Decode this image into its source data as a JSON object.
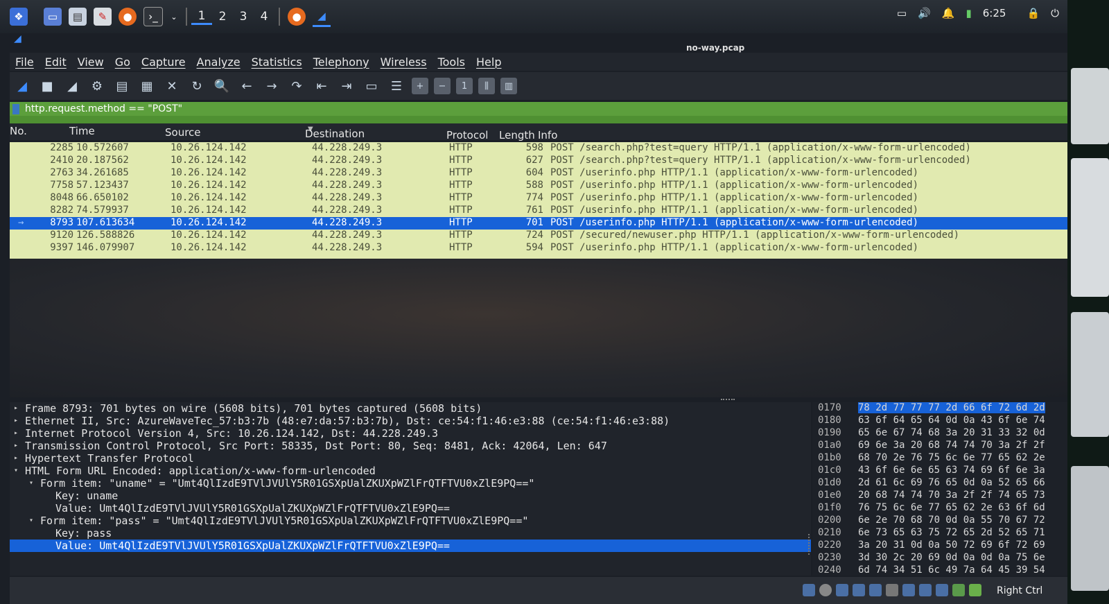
{
  "taskbar": {
    "workspaces": [
      "1",
      "2",
      "3",
      "4"
    ],
    "active_workspace": "1",
    "clock": "6:25"
  },
  "window": {
    "title": "no-way.pcap"
  },
  "menu": [
    "File",
    "Edit",
    "View",
    "Go",
    "Capture",
    "Analyze",
    "Statistics",
    "Telephony",
    "Wireless",
    "Tools",
    "Help"
  ],
  "filter": {
    "value": "http.request.method == \"POST\""
  },
  "columns": {
    "no": "No.",
    "time": "Time",
    "source": "Source",
    "destination": "Destination",
    "protocol": "Protocol",
    "length": "Length",
    "info": "Info"
  },
  "packets": [
    {
      "no": "2285",
      "time": "10.572607",
      "src": "10.26.124.142",
      "dst": "44.228.249.3",
      "proto": "HTTP",
      "len": "598",
      "info": "POST /search.php?test=query HTTP/1.1  (application/x-www-form-urlencoded)"
    },
    {
      "no": "2410",
      "time": "20.187562",
      "src": "10.26.124.142",
      "dst": "44.228.249.3",
      "proto": "HTTP",
      "len": "627",
      "info": "POST /search.php?test=query HTTP/1.1  (application/x-www-form-urlencoded)"
    },
    {
      "no": "2763",
      "time": "34.261685",
      "src": "10.26.124.142",
      "dst": "44.228.249.3",
      "proto": "HTTP",
      "len": "604",
      "info": "POST /userinfo.php HTTP/1.1  (application/x-www-form-urlencoded)"
    },
    {
      "no": "7758",
      "time": "57.123437",
      "src": "10.26.124.142",
      "dst": "44.228.249.3",
      "proto": "HTTP",
      "len": "588",
      "info": "POST /userinfo.php HTTP/1.1  (application/x-www-form-urlencoded)"
    },
    {
      "no": "8048",
      "time": "66.650102",
      "src": "10.26.124.142",
      "dst": "44.228.249.3",
      "proto": "HTTP",
      "len": "774",
      "info": "POST /userinfo.php HTTP/1.1  (application/x-www-form-urlencoded)"
    },
    {
      "no": "8282",
      "time": "74.579937",
      "src": "10.26.124.142",
      "dst": "44.228.249.3",
      "proto": "HTTP",
      "len": "761",
      "info": "POST /userinfo.php HTTP/1.1  (application/x-www-form-urlencoded)"
    },
    {
      "no": "8793",
      "time": "107.613634",
      "src": "10.26.124.142",
      "dst": "44.228.249.3",
      "proto": "HTTP",
      "len": "701",
      "info": "POST /userinfo.php HTTP/1.1  (application/x-www-form-urlencoded)"
    },
    {
      "no": "9120",
      "time": "126.588826",
      "src": "10.26.124.142",
      "dst": "44.228.249.3",
      "proto": "HTTP",
      "len": "724",
      "info": "POST /secured/newuser.php HTTP/1.1  (application/x-www-form-urlencoded)"
    },
    {
      "no": "9397",
      "time": "146.079907",
      "src": "10.26.124.142",
      "dst": "44.228.249.3",
      "proto": "HTTP",
      "len": "594",
      "info": "POST /userinfo.php HTTP/1.1  (application/x-www-form-urlencoded)"
    }
  ],
  "selected_packet": "8793",
  "details": [
    {
      "text": "Frame 8793: 701 bytes on wire (5608 bits), 701 bytes captured (5608 bits)",
      "arrow": "▸"
    },
    {
      "text": "Ethernet II, Src: AzureWaveTec_57:b3:7b (48:e7:da:57:b3:7b), Dst: ce:54:f1:46:e3:88 (ce:54:f1:46:e3:88)",
      "arrow": "▸"
    },
    {
      "text": "Internet Protocol Version 4, Src: 10.26.124.142, Dst: 44.228.249.3",
      "arrow": "▸"
    },
    {
      "text": "Transmission Control Protocol, Src Port: 58335, Dst Port: 80, Seq: 8481, Ack: 42064, Len: 647",
      "arrow": "▸"
    },
    {
      "text": "Hypertext Transfer Protocol",
      "arrow": "▸"
    },
    {
      "text": "HTML Form URL Encoded: application/x-www-form-urlencoded",
      "arrow": "▾"
    },
    {
      "text": "Form item: \"uname\" = \"Umt4QlIzdE9TVlJVUlY5R01GSXpUalZKUXpWZlFrQTFTVU0xZlE9PQ==\"",
      "arrow": "▾"
    },
    {
      "text": "Key: uname",
      "arrow": ""
    },
    {
      "text": "Value: Umt4QlIzdE9TVlJVUlY5R01GSXpUalZKUXpWZlFrQTFTVU0xZlE9PQ==",
      "arrow": ""
    },
    {
      "text": "Form item: \"pass\" = \"Umt4QlIzdE9TVlJVUlY5R01GSXpUalZKUXpWZlFrQTFTVU0xZlE9PQ==\"",
      "arrow": "▾"
    },
    {
      "text": "Key: pass",
      "arrow": ""
    },
    {
      "text": "Value: Umt4QlIzdE9TVlJVUlY5R01GSXpUalZKUXpWZlFrQTFTVU0xZlE9PQ==",
      "arrow": ""
    }
  ],
  "hex": [
    {
      "off": "0170",
      "hex": "78 2d 77 77 77 2d 66 6f  72 6d 2d"
    },
    {
      "off": "0180",
      "hex": "63 6f 64 65 64 0d 0a 43  6f 6e 74"
    },
    {
      "off": "0190",
      "hex": "65 6e 67 74 68 3a 20 31  33 32 0d"
    },
    {
      "off": "01a0",
      "hex": "69 6e 3a 20 68 74 74 70  3a 2f 2f"
    },
    {
      "off": "01b0",
      "hex": "68 70 2e 76 75 6c 6e 77  65 62 2e"
    },
    {
      "off": "01c0",
      "hex": "43 6f 6e 6e 65 63 74 69  6f 6e 3a"
    },
    {
      "off": "01d0",
      "hex": "2d 61 6c 69 76 65 0d 0a  52 65 66"
    },
    {
      "off": "01e0",
      "hex": "20 68 74 74 70 3a 2f 2f  74 65 73"
    },
    {
      "off": "01f0",
      "hex": "76 75 6c 6e 77 65 62 2e  63 6f 6d"
    },
    {
      "off": "0200",
      "hex": "6e 2e 70 68 70 0d 0a 55  70 67 72"
    },
    {
      "off": "0210",
      "hex": "6e 73 65 63 75 72 65 2d  52 65 71"
    },
    {
      "off": "0220",
      "hex": "3a 20 31 0d 0a 50 72 69  6f 72 69"
    },
    {
      "off": "0230",
      "hex": "3d 30 2c 20 69 0d 0a 0d  0a 75 6e"
    },
    {
      "off": "0240",
      "hex": "6d 74 34 51 6c 49 7a 64  45 39 54"
    }
  ],
  "statusbar": {
    "host_key": "Right Ctrl"
  },
  "colors": {
    "selection": "#1762d8",
    "http_row": "#e1eab0",
    "filter_valid": "#5c9f3c"
  }
}
